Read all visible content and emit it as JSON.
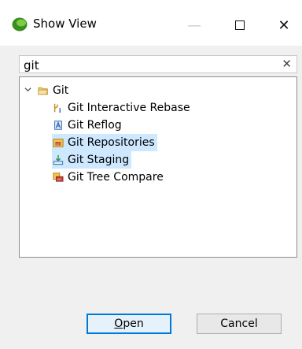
{
  "window": {
    "title": "Show View",
    "minimize_glyph": "—",
    "close_glyph": "✕"
  },
  "search": {
    "value": "git",
    "clear_glyph": "✕"
  },
  "tree": {
    "group": {
      "label": "Git",
      "expanded": true,
      "icon": "folder-icon"
    },
    "items": [
      {
        "label": "Git Interactive Rebase",
        "icon": "interactive-rebase-icon",
        "selected": false
      },
      {
        "label": "Git Reflog",
        "icon": "reflog-icon",
        "selected": false
      },
      {
        "label": "Git Repositories",
        "icon": "repositories-icon",
        "selected": true
      },
      {
        "label": "Git Staging",
        "icon": "staging-icon",
        "selected": true
      },
      {
        "label": "Git Tree Compare",
        "icon": "tree-compare-icon",
        "selected": false
      }
    ]
  },
  "buttons": {
    "open_mnemonic": "O",
    "open_rest": "pen",
    "cancel": "Cancel"
  },
  "colors": {
    "selection": "#cde8ff",
    "default_button_border": "#0078d7"
  }
}
